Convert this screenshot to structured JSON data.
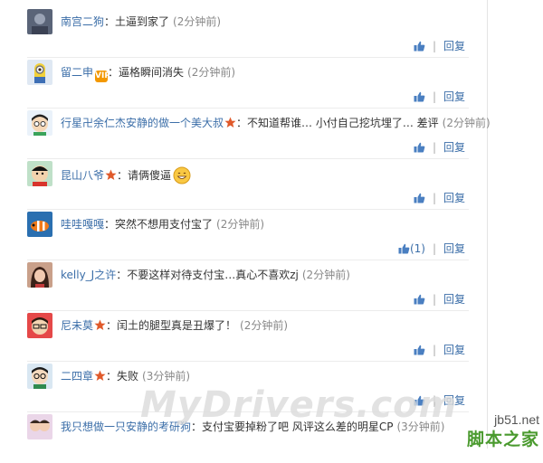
{
  "reply_label": "回复",
  "separator": "|",
  "colors": {
    "username": "#3b6ea8",
    "time": "#888888",
    "vip": "#f39800",
    "star": "#e05a2b"
  },
  "comments": [
    {
      "user": "南宫二狗",
      "text": "土逼到家了",
      "time": "(2分钟前)",
      "avatar": "dark-photo-avatar"
    },
    {
      "user": "留二申",
      "vip": "VIP",
      "text": "逼格瞬间消失",
      "time": "(2分钟前)",
      "avatar": "minion-avatar"
    },
    {
      "user": "行星卍余仁杰安静的做一个美大叔",
      "text": "不知道帮谁… 小付自己挖坑埋了… 差评",
      "time": "(2分钟前)",
      "avatar": "cartoon-boy-avatar"
    },
    {
      "user": "昆山八爷",
      "text": "请俩傻逼",
      "time": "(2分钟前)",
      "avatar": "crayon-shin-avatar"
    },
    {
      "user": "哇哇嘎嘎",
      "text": "突然不想用支付宝了",
      "time": "(2分钟前)",
      "avatar": "clownfish-avatar",
      "likes": "(1)"
    },
    {
      "user": "kelly_J之许",
      "text": "不要这样对待支付宝…真心不喜欢zj",
      "time": "(2分钟前)",
      "avatar": "girl-photo-avatar"
    },
    {
      "user": "尼未莫",
      "text": "闰土的腿型真是丑爆了！",
      "time": "(2分钟前)",
      "avatar": "glasses-cartoon-avatar"
    },
    {
      "user": "二四章",
      "text": "失败",
      "time": "(3分钟前)",
      "avatar": "glasses-boy-avatar"
    },
    {
      "user": "我只想做一只安静的考研狗",
      "text": "支付宝要掉粉了吧 风评这么差的明星CP",
      "time": "(3分钟前)",
      "avatar": "couple-avatar"
    }
  ],
  "watermark": "MyDrivers.com",
  "brand": {
    "site": "jb51.net",
    "name": "脚本之家"
  }
}
